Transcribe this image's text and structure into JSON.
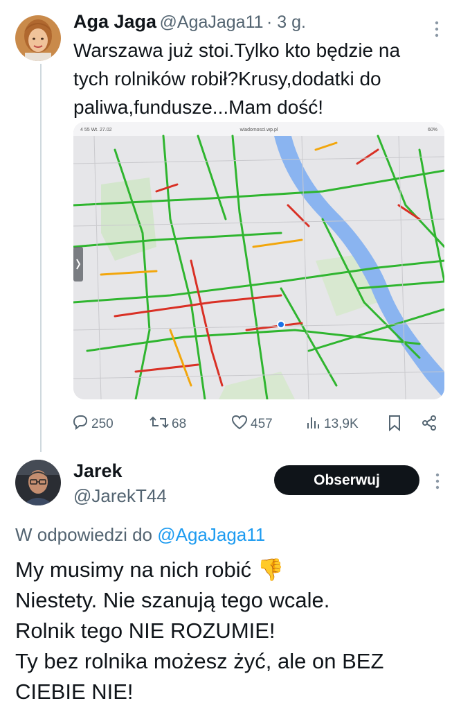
{
  "tweet": {
    "author_name": "Aga Jaga",
    "author_handle": "@AgaJaga11",
    "time": "· 3 g.",
    "lines": [
      "Warszawa już stoi.Tylko kto będzie na",
      "tych rolników robił?Krusy,dodatki do",
      "paliwa,fundusze...Mam dość!"
    ],
    "media": {
      "status_left": "4 55  Wt. 27.02",
      "status_url": "wiadomosci.wp.pl",
      "status_right": "60%"
    },
    "actions": {
      "replies": "250",
      "retweets": "68",
      "likes": "457",
      "views": "13,9K"
    }
  },
  "reply": {
    "author_name": "Jarek",
    "author_handle": "@JarekT44",
    "follow_label": "Obserwuj",
    "reply_to_prefix": "W odpowiedzi do",
    "reply_to_handle": "@AgaJaga11",
    "lines": [
      "My musimy na nich robić",
      "Niestety. Nie szanują tego wcale.",
      "Rolnik tego NIE ROZUMIE!",
      "Ty bez rolnika możesz żyć, ale on BEZ",
      "CIEBIE NIE!"
    ],
    "emoji": "👎"
  },
  "colors": {
    "text": "#0f1419",
    "secondary": "#536471",
    "link": "#1d9bf0",
    "traffic_green": "#2fb52f",
    "traffic_red": "#d93025",
    "river": "#8ab4f0"
  },
  "icons": [
    "reply-icon",
    "retweet-icon",
    "like-icon",
    "views-icon",
    "bookmark-icon",
    "share-icon",
    "more-icon"
  ]
}
